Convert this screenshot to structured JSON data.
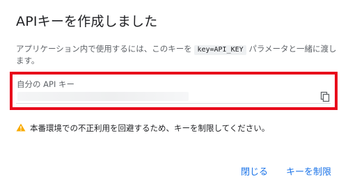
{
  "dialog": {
    "title": "APIキーを作成しました",
    "description": {
      "before": "アプリケーション内で使用するには、このキーを ",
      "code": "key=API_KEY",
      "after": " パラメータと一緒に渡します。"
    },
    "field": {
      "label": "自分の API キー",
      "value": ""
    },
    "warning": "本番環境での不正利用を回避するため、キーを制限してください。",
    "actions": {
      "close": "閉じる",
      "restrict": "キーを制限"
    }
  },
  "colors": {
    "highlight": "#e8071b",
    "link": "#1a73e8",
    "warning": "#f9ab00"
  },
  "icons": {
    "copy": "copy-icon",
    "warning": "warning-icon"
  }
}
